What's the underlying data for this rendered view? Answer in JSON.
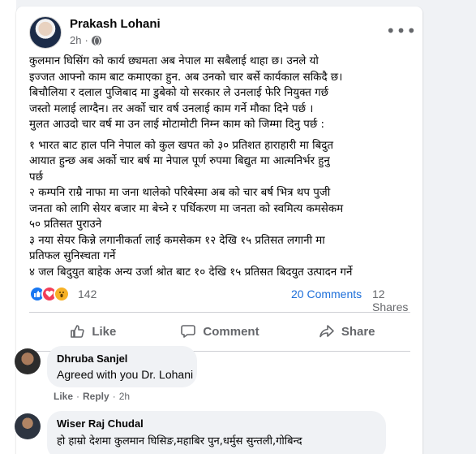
{
  "post": {
    "author": "Prakash Lohani",
    "time": "2h",
    "more": "•••",
    "paragraphs": [
      "कुलमान  घिसिंग को कार्य छ्यमता   अब नेपाल मा सबैलाई थाहा छ।  उनले यो",
      "इज्जत आफ्नो काम बाट कमाएका हुन. अब उनको चार बर्से कार्यकाल सकिदै छ।",
      "बिचौलिया र दलाल पुजिबाद मा डुबेको यो सरकार ले उनलाई फेरि नियुक्त गर्छ",
      "जस्तो मलाई लाग्दैन।  तर  अर्को चार वर्ष उनलाई  काम  गर्ने मौका दिने  पर्छ ।",
      "मुलत आउदो चार वर्ष मा उन लाई  मोटामोटी निम्न काम  को जिम्मा दिनु पर्छ :",
      "",
      "१ भारत बाट हाल पनि नेपाल को कुल खपत को  ३० प्रतिशत हाराहारी मा बिदुत",
      "आयात  हुन्छ अब अर्को चार बर्ष  मा नेपाल पूर्ण रुपमा बिद्युत मा आत्मनिर्भर  हुनु",
      "पर्छ",
      "२ कम्पनि  राम्रै  नाफा मा जना थालेको  परिबेस्मा अब को चार बर्ष  भित्र थप पुजी",
      "जनता को लागि  सेयर बजार मा बेच्ने र   पर्धिकरण मा जनता को स्वमित्य कमसेकम",
      "५० प्रतिसत पुराउने",
      "३ नया सेयर किन्ने लगानीकर्ता लाई  कमसेकम १२ देखि १५ प्रतिसत लगानी मा",
      "प्रतिफल सुनिस्चता गर्ने",
      "४ जल बिदुयुत बाहेक अन्य उर्जा श्रोत बाट १० देखि १५ प्रतिसत बिदयुत उत्पादन गर्ने"
    ]
  },
  "stats": {
    "reaction_count": "142",
    "comments": "20 Comments",
    "shares": "12 Shares"
  },
  "actions": {
    "like": "Like",
    "comment": "Comment",
    "share": "Share"
  },
  "comments": [
    {
      "name": "Dhruba Sanjel",
      "text": "Agreed with you Dr. Lohani",
      "like": "Like",
      "reply": "Reply",
      "time": "2h"
    },
    {
      "name": "Wiser Raj Chudal",
      "text": "हो हाम्रो देशमा कुलमान घिसिङ,महाबिर पुन,धर्मुस सुन्तली,गोबिन्द"
    }
  ],
  "icons": {
    "like": "thumbs-up-icon",
    "comment": "speech-bubble-icon",
    "share": "share-arrow-icon"
  },
  "colors": {
    "link_blue": "#1c6ed9",
    "like_blue": "#1877f2",
    "love_red": "#f33e58",
    "wow_yellow": "#f7b125",
    "muted_text": "#65676b"
  }
}
